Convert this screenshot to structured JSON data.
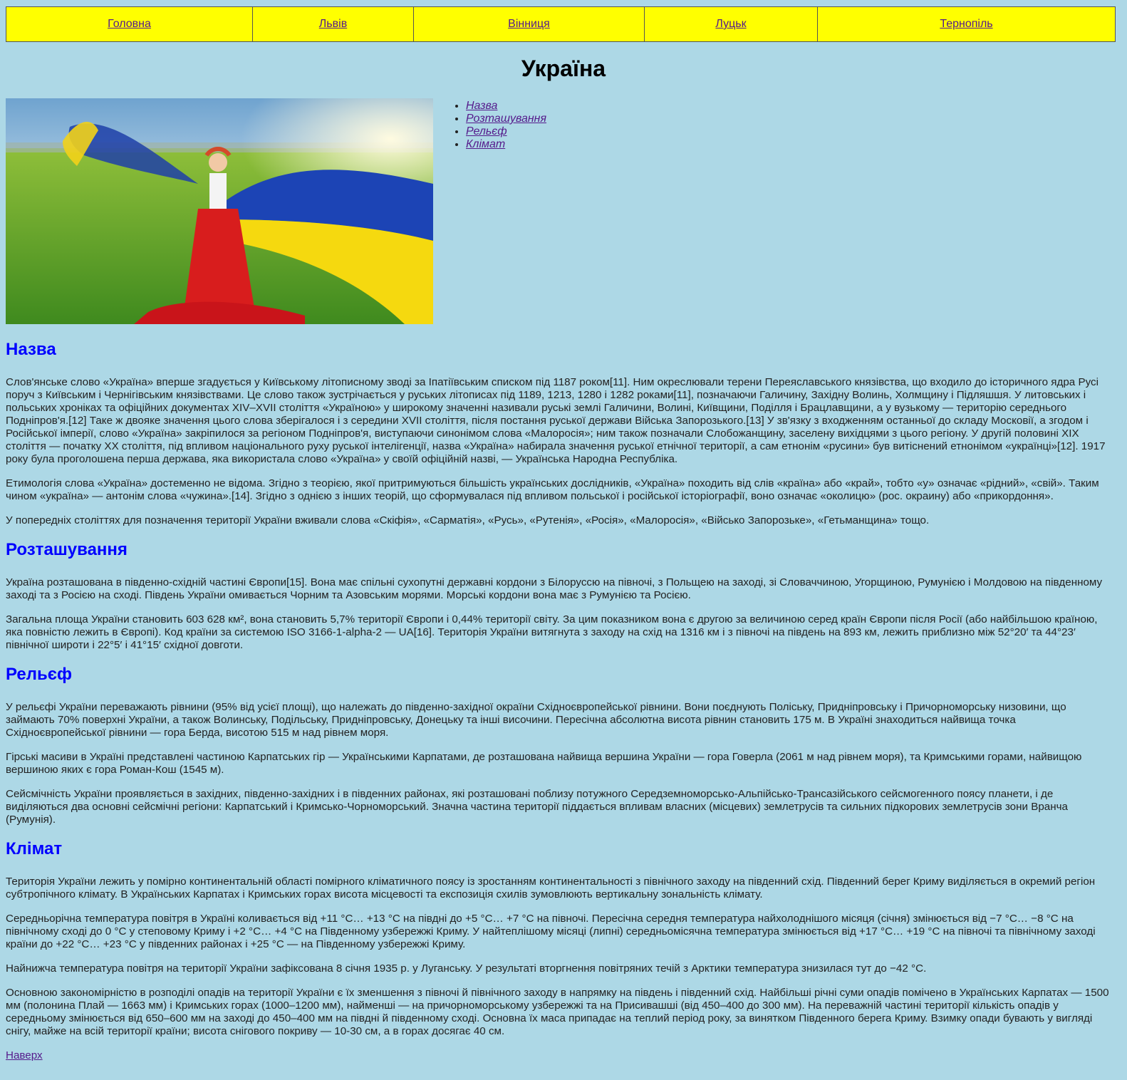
{
  "nav": {
    "items": [
      "Головна",
      "Львів",
      "Вінниця",
      "Луцьк",
      "Тернопіль"
    ]
  },
  "page_title": "Україна",
  "toc": {
    "items": [
      "Назва",
      "Розташування",
      "Рельєф",
      "Клімат"
    ]
  },
  "sections": {
    "name": {
      "title": "Назва",
      "p1": "Слов'янське слово «Україна» вперше згадується у Київському літописному зводі за Іпатіївським списком під 1187 роком[11]. Ним окреслювали терени Переяславського князівства, що входило до історичного ядра Русі поруч з Київським і Чернігівським князівствами. Це слово також зустрічається у руських літописах під 1189, 1213, 1280 і 1282 роками[11], позначаючи Галичину, Західну Волинь, Холмщину і Підляшшя. У литовських і польських хроніках та офіційних документах XIV–XVII століття «Україною» у широкому значенні називали руські землі Галичини, Волині, Київщини, Поділля і Брацлавщини, а у вузькому — територію середнього Подніпров'я.[12] Таке ж двояке значення цього слова зберігалося і з середини XVII століття, після постання руської держави Війська Запорозького.[13] У зв'язку з входженням останньої до складу Московії, а згодом і Російської імперії, слово «Україна» закріпилося за регіоном Подніпров'я, виступаючи синонімом слова «Малоросія»; ним також позначали Слобожанщину, заселену вихідцями з цього регіону. У другій половині XIX століття — початку XX століття, під впливом національного руху руської інтелігенції, назва «Україна» набирала значення руської етнічної території, а сам етнонім «русини» був витіснений етнонімом «українці»[12]. 1917 року була проголошена перша держава, яка використала слово «Україна» у своїй офіційній назві, — Українська Народна Республіка.",
      "p2": "Етимологія слова «Україна» достеменно не відома. Згідно з теорією, якої притримуються більшість українських дослідників, «Україна» походить від слів «країна» або «край», тобто «у» означає «рідний», «свій». Таким чином «україна» — антонім слова «чужина».[14]. Згідно з однією з інших теорій, що сформувалася під впливом польської і російської історіографії, воно означає «околицю» (рос. окраину) або «прикордоння».",
      "p3": "У попередніх століттях для позначення території України вживали слова «Скіфія», «Сарматія», «Русь», «Рутенія», «Росія», «Малоросія», «Військо Запорозьке», «Гетьманщина» тощо."
    },
    "location": {
      "title": "Розташування",
      "p1": "Україна розташована в південно-східній частині Європи[15]. Вона має спільні сухопутні державні кордони з Білоруссю на півночі, з Польщею на заході, зі Словаччиною, Угорщиною, Румунією і Молдовою на південному заході та з Росією на сході. Південь України омивається Чорним та Азовським морями. Морські кордони вона має з Румунією та Росією.",
      "p2": "Загальна площа України становить 603 628 км², вона становить 5,7% території Європи і 0,44% території світу. За цим показником вона є другою за величиною серед країн Європи після Росії (або найбільшою країною, яка повністю лежить в Європі). Код країни за системою ISO 3166-1-alpha-2 — UA[16]. Територія України витягнута з заходу на схід на 1316 км і з півночі на південь на 893 км, лежить приблизно між 52°20′ та 44°23′ північної широти і 22°5′ і 41°15′ східної довготи."
    },
    "relief": {
      "title": "Рельєф",
      "p1": "У рельєфі України переважають рівнини (95% від усієї площі), що належать до південно-західної окраїни Східноєвропейської рівнини. Вони поєднують Поліську, Придніпровську і Причорноморську низовини, що займають 70% поверхні України, а також Волинську, Подільську, Придніпровську, Донецьку та інші височини. Пересічна абсолютна висота рівнин становить 175 м. В Україні знаходиться найвища точка Східноєвропейської рівнини — гора Берда, висотою 515 м над рівнем моря.",
      "p2": "Гірські масиви в Україні представлені частиною Карпатських гір — Українськими Карпатами, де розташована найвища вершина України — гора Говерла (2061 м над рівнем моря), та Кримськими горами, найвищою вершиною яких є гора Роман-Кош (1545 м).",
      "p3": "Сейсмічність України проявляється в західних, південно-західних і в південних районах, які розташовані поблизу потужного Середземноморсько-Альпійсько-Трансазійського сейсмогенного поясу планети, і де виділяються два основні сейсмічні регіони: Карпатський і Кримсько-Чорноморський. Значна частина території піддається впливам власних (місцевих) землетрусів та сильних підкорових землетрусів зони Вранча (Румунія)."
    },
    "climate": {
      "title": "Клімат",
      "p1": "Територія України лежить у помірно континентальній області помірного кліматичного поясу із зростанням континентальності з північного заходу на південний схід. Південний берег Криму виділяється в окремий регіон субтропічного клімату. В Українських Карпатах і Кримських горах висота місцевості та експозиція схилів зумовлюють вертикальну зональність клімату.",
      "p2": "Середньорічна температура повітря в Україні коливається від +11 °C… +13 °C на півдні до +5 °C… +7 °C на півночі. Пересічна середня температура найхолоднішого місяця (січня) змінюється від −7 °C… −8 °C на північному сході до 0 °C у степовому Криму і +2 °C… +4 °C на Південному узбережжі Криму. У найтеплішому місяці (липні) середньомісячна температура змінюється від +17 °C… +19 °C на півночі та північному заході країни до +22 °C… +23 °C у південних районах і +25 °C — на Південному узбережжі Криму.",
      "p3": "Найнижча температура повітря на території України зафіксована 8 січня 1935 р. у Луганську. У результаті вторгнення повітряних течій з Арктики температура знизилася тут до −42 °C.",
      "p4": "Основною закономірністю в розподілі опадів на території України є їх зменшення з півночі й північного заходу в напрямку на південь і південний схід. Найбільші річні суми опадів помічено в Українських Карпатах — 1500 мм (полонина Плай — 1663 мм) і Кримських горах (1000–1200 мм), найменші — на причорноморському узбережжі та на Присивашші (від 450–400 до 300 мм). На переважній частині території кількість опадів у середньому змінюється від 650–600 мм на заході до 450–400 мм на півдні й південному сході. Основна їх маса припадає на теплий період року, за винятком Південного берега Криму. Взимку опади бувають у вигляді снігу, майже на всій території країни; висота снігового покриву — 10-30 см, а в горах досягає 40 см."
    }
  },
  "back_to_top": "Наверх",
  "colors": {
    "background": "#add8e6",
    "nav_background": "#ffff00",
    "heading": "#0000ff",
    "link": "#551a8b"
  }
}
